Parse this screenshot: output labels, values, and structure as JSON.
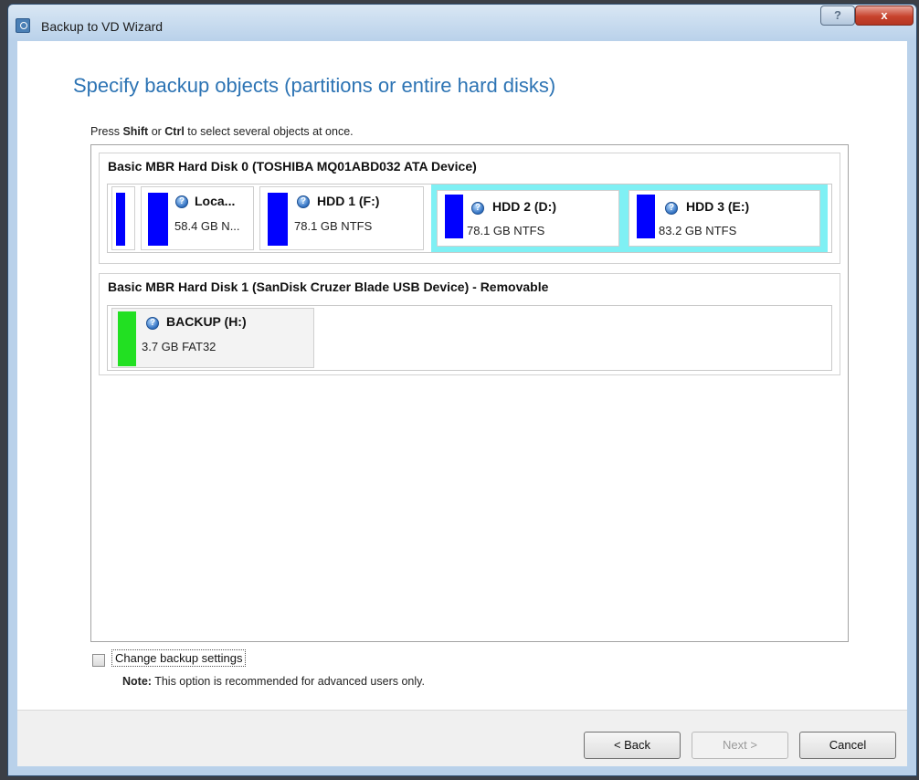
{
  "window": {
    "title": "Backup to VD Wizard",
    "help_label": "?",
    "close_label": "x"
  },
  "main": {
    "heading": "Specify backup objects (partitions or entire hard disks)",
    "hint": {
      "prefix": "Press ",
      "shift": "Shift",
      "or": " or ",
      "ctrl": "Ctrl",
      "suffix": " to select several objects at once."
    }
  },
  "disks": [
    {
      "title": "Basic MBR Hard Disk 0 (TOSHIBA MQ01ABD032 ATA Device)",
      "partitions": [
        {
          "name": "",
          "info": "",
          "color": "#0000ff",
          "selected": false
        },
        {
          "name": "Loca...",
          "info": "58.4 GB N...",
          "color": "#0000ff",
          "selected": false
        },
        {
          "name": "HDD 1 (F:)",
          "info": "78.1 GB NTFS",
          "color": "#0000ff",
          "selected": false
        },
        {
          "name": "HDD 2 (D:)",
          "info": "78.1 GB NTFS",
          "color": "#0000ff",
          "selected": true
        },
        {
          "name": "HDD 3 (E:)",
          "info": "83.2 GB NTFS",
          "color": "#0000ff",
          "selected": true
        }
      ]
    },
    {
      "title": "Basic MBR Hard Disk 1 (SanDisk Cruzer Blade USB Device) - Removable",
      "partitions": [
        {
          "name": "BACKUP (H:)",
          "info": "3.7 GB FAT32",
          "color": "#22e022",
          "selected": false
        }
      ]
    }
  ],
  "options": {
    "change_settings_label": "Change backup settings",
    "change_settings_checked": false,
    "note_label": "Note:",
    "note_text": " This option is recommended for advanced users only."
  },
  "buttons": {
    "back": "< Back",
    "next": "Next >",
    "cancel": "Cancel"
  },
  "icons": {
    "partition_status": "question-icon",
    "app": "wizard-icon"
  },
  "colors": {
    "heading": "#2d74b4",
    "selection": "#7ff0f4",
    "ntfs_partition": "#0000ff",
    "fat32_partition": "#22e022"
  }
}
